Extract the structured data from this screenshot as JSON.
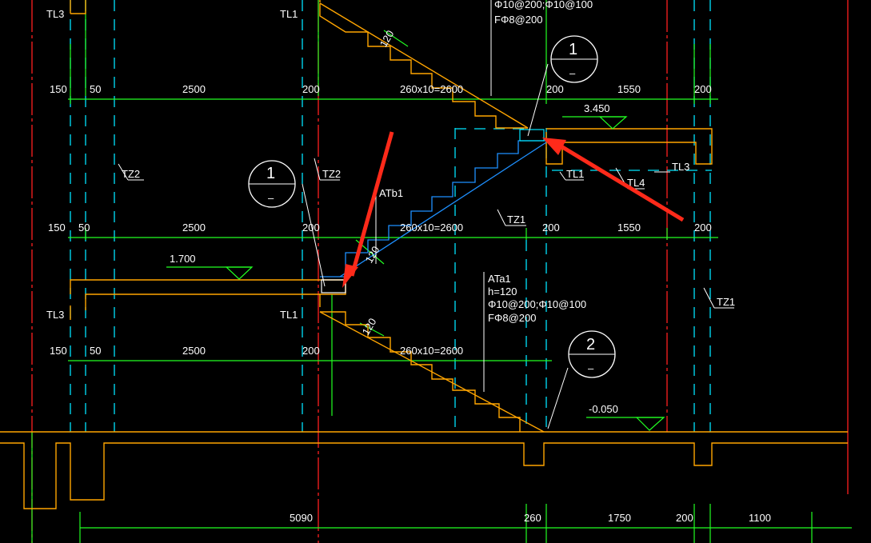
{
  "dims": {
    "row1": [
      "150",
      "50",
      "2500",
      "200",
      "260x10=2600",
      "200",
      "1550",
      "200"
    ],
    "row2": [
      "150",
      "50",
      "2500",
      "200",
      "260x10=2600",
      "200",
      "1550",
      "200"
    ],
    "row3": [
      "150",
      "50",
      "2500",
      "200",
      "260x10=2600"
    ],
    "bottom": [
      "5090",
      "260",
      "1750",
      "200",
      "1100"
    ]
  },
  "labels": {
    "tl3_top": "TL3",
    "tl1_top": "TL1",
    "tz2_left": "TZ2",
    "tz2_mid": "TZ2",
    "tl1_right": "TL1",
    "tl4": "TL4",
    "tl3_right": "TL3",
    "tz1_mid": "TZ1",
    "tz1_right": "TZ1",
    "tl3_left": "TL3",
    "tl1_left": "TL1",
    "atb1": "ATb1",
    "ata1": "ATa1",
    "ata1_h": "h=120",
    "ata1_rebar1": "Φ10@200;Φ10@100",
    "ata1_rebar2": "FΦ8@200",
    "top_rebar1": "Φ10@200;Φ10@100",
    "top_rebar2": "FΦ8@200",
    "slope_top": "120",
    "slope_mid": "120",
    "slope_bot": "120"
  },
  "elevations": {
    "upper": "3.450",
    "middle": "1.700",
    "ground": "-0.050"
  },
  "section_marks": [
    {
      "number": "1",
      "sub": "–"
    },
    {
      "number": "1",
      "sub": "–"
    },
    {
      "number": "2",
      "sub": "–"
    }
  ],
  "colors": {
    "background": "#000000",
    "dimension": "#00ff00",
    "axis": "#ff0000",
    "hidden": "#00ffff",
    "structure": "#ffa500",
    "stair_upper": "#1e90ff",
    "annotation": "#ffffff",
    "arrow": "#ff2a1a"
  }
}
